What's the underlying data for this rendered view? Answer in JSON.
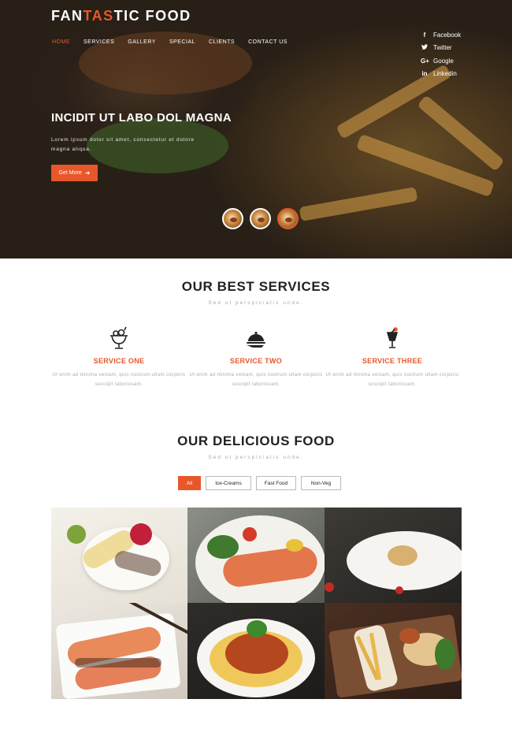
{
  "brand": {
    "part1": "FAN",
    "part2": "TAS",
    "part3": "TIC FOOD",
    "accent_color": "#e8572a"
  },
  "nav": {
    "items": [
      {
        "label": "HOME",
        "active": true
      },
      {
        "label": "SERVICES",
        "active": false
      },
      {
        "label": "GALLERY",
        "active": false
      },
      {
        "label": "SPECIAL",
        "active": false
      },
      {
        "label": "CLIENTS",
        "active": false
      },
      {
        "label": "CONTACT US",
        "active": false
      }
    ]
  },
  "social": [
    {
      "icon": "facebook-icon",
      "label": "Facebook"
    },
    {
      "icon": "twitter-icon",
      "label": "Twitter"
    },
    {
      "icon": "google-plus-icon",
      "label": "Google"
    },
    {
      "icon": "linkedin-icon",
      "label": "Linkedin"
    }
  ],
  "hero": {
    "title": "INCIDIT UT LABO DOL MAGNA",
    "text": "Lorem ipsum dolor sit amet, consectetur et dolore magna aliqua.",
    "button_label": "Get More",
    "button_icon": "arrow-right-icon",
    "slides_count": 3,
    "active_slide": 1
  },
  "services": {
    "title": "OUR BEST SERVICES",
    "subtitle": "Sed ut perspiciatis unde.",
    "items": [
      {
        "icon": "ice-cream-sundae-icon",
        "name": "SERVICE ONE",
        "desc": "Ut enim ad minima veniam, quis nostrum ullam corporis suscipit laboriosam."
      },
      {
        "icon": "serving-cloche-icon",
        "name": "SERVICE TWO",
        "desc": "Ut enim ad minima veniam, quis nostrum ullam corporis suscipit laboriosam."
      },
      {
        "icon": "cocktail-glass-icon",
        "name": "SERVICE THREE",
        "desc": "Ut enim ad minima veniam, quis nostrum ullam corporis suscipit laboriosam."
      }
    ]
  },
  "food": {
    "title": "OUR DELICIOUS FOOD",
    "subtitle": "Sed ut perspiciatis unde.",
    "filters": [
      {
        "label": "All",
        "active": true
      },
      {
        "label": "Ice-Creams",
        "active": false
      },
      {
        "label": "Fast Food",
        "active": false
      },
      {
        "label": "Non-Veg",
        "active": false
      }
    ],
    "gallery": [
      {
        "name": "banana-split-dessert"
      },
      {
        "name": "grilled-salmon-plate"
      },
      {
        "name": "gourmet-dessert-plate"
      },
      {
        "name": "salmon-with-chopsticks"
      },
      {
        "name": "spaghetti-bolognese"
      },
      {
        "name": "fries-and-chicken-board"
      }
    ]
  }
}
